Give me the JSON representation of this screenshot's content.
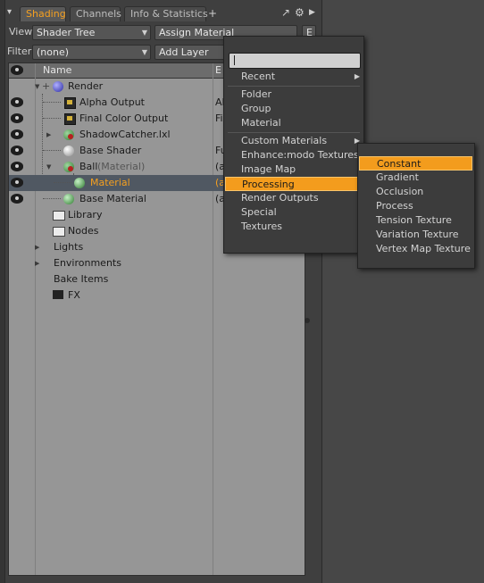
{
  "tabs": [
    "Shading",
    "Channels",
    "Info & Statistics",
    "+"
  ],
  "toolbar": {
    "view_label": "View",
    "view_value": "Shader Tree",
    "assign_material": "Assign Material",
    "assign_extra": "E",
    "filter_label": "Filter",
    "filter_value": "(none)",
    "add_layer": "Add Layer"
  },
  "tree": {
    "headers": {
      "name": "Name",
      "effect": "E"
    },
    "rows": [
      {
        "name": "Render",
        "effect": ""
      },
      {
        "name": "Alpha Output",
        "effect": "Al"
      },
      {
        "name": "Final Color Output",
        "effect": "Fi"
      },
      {
        "name": "ShadowCatcher.lxl",
        "effect": ""
      },
      {
        "name": "Base Shader",
        "effect": "Fu"
      },
      {
        "name": "Ball",
        "suffix": "(Material)",
        "effect": "(a"
      },
      {
        "name": "Material",
        "effect": "(a"
      },
      {
        "name": "Base Material",
        "effect": "(a"
      },
      {
        "name": "Library"
      },
      {
        "name": "Nodes"
      },
      {
        "name": "Lights"
      },
      {
        "name": "Environments"
      },
      {
        "name": "Bake Items"
      },
      {
        "name": "FX"
      }
    ]
  },
  "menu": {
    "search_value": "",
    "items": [
      "Recent",
      "Folder",
      "Group",
      "Material",
      "Custom Materials",
      "Enhance:modo Textures",
      "Image Map",
      "Processing",
      "Render Outputs",
      "Special",
      "Textures"
    ],
    "highlighted": "Processing"
  },
  "submenu": {
    "items": [
      "Constant",
      "Gradient",
      "Occlusion",
      "Process",
      "Tension Texture",
      "Variation Texture",
      "Vertex Map Texture"
    ],
    "highlighted": "Constant"
  },
  "colors": {
    "accent": "#f5a020",
    "highlight": "#f39c1d",
    "selected_row": "#505862"
  },
  "icons": [
    "grip-icon",
    "detach-icon",
    "gear-icon",
    "arrow-right-icon",
    "eye-icon",
    "sphere-icon",
    "folder-icon",
    "clapper-icon"
  ]
}
